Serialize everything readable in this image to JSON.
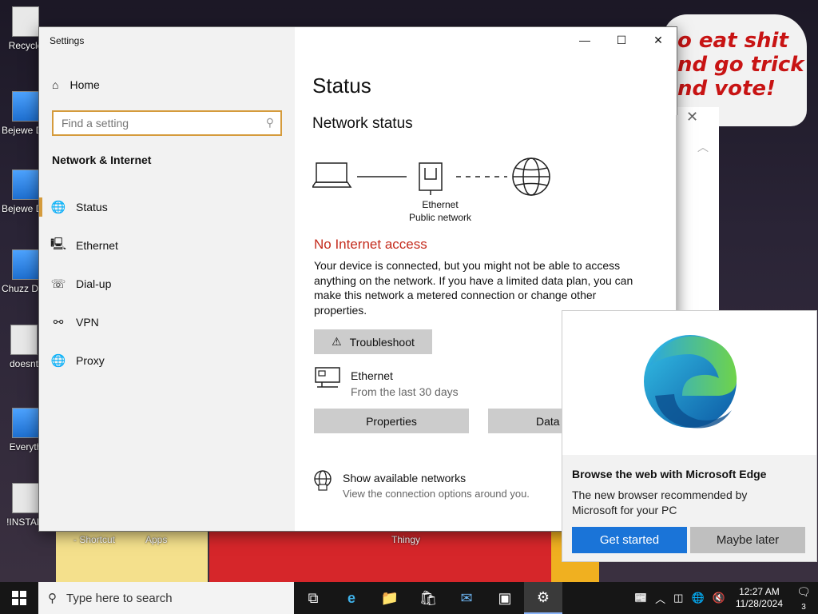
{
  "desktop": {
    "icons": [
      {
        "label": "Recycle",
        "style": "plain"
      },
      {
        "label": "Bejewe Delux",
        "style": "blue"
      },
      {
        "label": "Bejewe Delux",
        "style": "blue"
      },
      {
        "label": "Chuzz Delux",
        "style": "blue"
      },
      {
        "label": "doesnt",
        "style": "plain"
      },
      {
        "label": "Everyth",
        "style": "blue"
      },
      {
        "label": "!INSTALI",
        "style": "plain"
      }
    ],
    "bottom_labels": [
      "- Shortcut",
      "Apps",
      "Thingy"
    ],
    "speech_text": "o eat shit nd go trick nd vote!"
  },
  "settings": {
    "window_title": "Settings",
    "controls": {
      "minimize": "—",
      "maximize": "☐",
      "close": "✕"
    },
    "sidebar": {
      "home": "Home",
      "search_placeholder": "Find a setting",
      "section": "Network & Internet",
      "items": [
        {
          "label": "Status",
          "icon": "globe-icon",
          "glyph": "🌐"
        },
        {
          "label": "Ethernet",
          "icon": "ethernet-icon",
          "glyph": "🖳"
        },
        {
          "label": "Dial-up",
          "icon": "dialup-icon",
          "glyph": "☏"
        },
        {
          "label": "VPN",
          "icon": "vpn-icon",
          "glyph": "⚯"
        },
        {
          "label": "Proxy",
          "icon": "proxy-icon",
          "glyph": "🌐"
        }
      ]
    },
    "main": {
      "title": "Status",
      "network_status_heading": "Network status",
      "diagram_label_1": "Ethernet",
      "diagram_label_2": "Public network",
      "error_heading": "No Internet access",
      "description": "Your device is connected, but you might not be able to access anything on the network. If you have a limited data plan, you can make this network a metered connection or change other properties.",
      "troubleshoot_label": "Troubleshoot",
      "ethernet_name": "Ethernet",
      "ethernet_sub": "From the last 30 days",
      "properties_label": "Properties",
      "data_usage_label": "Data",
      "show_networks_title": "Show available networks",
      "show_networks_sub": "View the connection options around you."
    }
  },
  "edge_popup": {
    "title": "Browse the web with Microsoft Edge",
    "description": "The new browser recommended by Microsoft for your PC",
    "primary_label": "Get started",
    "secondary_label": "Maybe later"
  },
  "taskbar": {
    "search_placeholder": "Type here to search",
    "apps": [
      {
        "name": "task-view",
        "glyph": "⧉"
      },
      {
        "name": "edge",
        "glyph": "e"
      },
      {
        "name": "file-explorer",
        "glyph": "📁"
      },
      {
        "name": "store",
        "glyph": "🛍"
      },
      {
        "name": "mail",
        "glyph": "✉"
      },
      {
        "name": "app-window",
        "glyph": "▣"
      },
      {
        "name": "settings",
        "glyph": "⚙"
      }
    ],
    "time": "12:27 AM",
    "date": "11/28/2024",
    "notification_count": "3"
  },
  "colors": {
    "accent": "#d59b3c",
    "error": "#c42b1c",
    "edge_primary": "#1a74d8"
  }
}
